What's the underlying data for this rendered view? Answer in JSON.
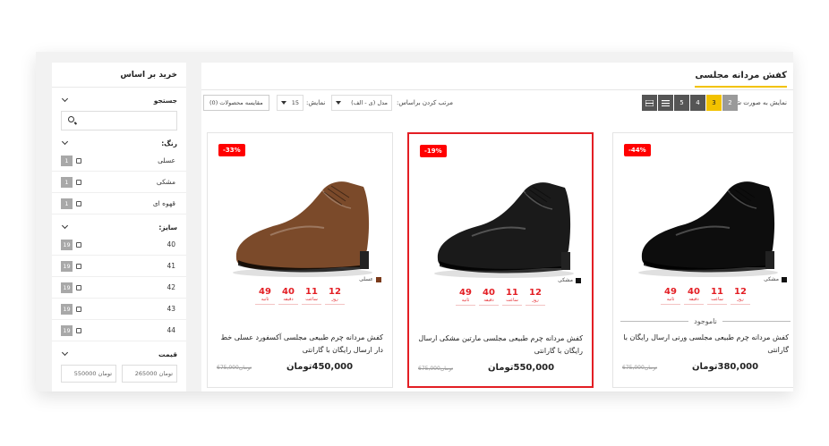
{
  "sidebar": {
    "title": "خرید بر اساس",
    "search_label": "جستجو",
    "color_label": "رنگ:",
    "colors": [
      {
        "label": "عسلی",
        "count": "1"
      },
      {
        "label": "مشکی",
        "count": "1"
      },
      {
        "label": "قهوه ای",
        "count": "1"
      }
    ],
    "size_label": "سایز:",
    "sizes": [
      {
        "label": "40",
        "count": "19"
      },
      {
        "label": "41",
        "count": "19"
      },
      {
        "label": "42",
        "count": "19"
      },
      {
        "label": "43",
        "count": "19"
      },
      {
        "label": "44",
        "count": "19"
      }
    ],
    "price_label": "قیمت",
    "price_min": "تومان 265000",
    "price_max": "تومان 550000"
  },
  "main": {
    "title": "کفش مردانه مجلسی",
    "view_label": "نمایش به صورت شبکه:",
    "pages": [
      "2",
      "3",
      "4",
      "5"
    ],
    "active_page": "3",
    "sort_label": "مرتب کردن براساس:",
    "sort_value": "مدل (ی - الف)",
    "show_label": "نمایش:",
    "show_value": "15",
    "compare_label": "مقایسه محصولات (0)"
  },
  "products": [
    {
      "badge": "-44%",
      "color_name": "مشکی",
      "swatch": "#111111",
      "timer": {
        "days": "12",
        "hours": "11",
        "minutes": "40",
        "seconds": "49"
      },
      "timer_units": {
        "days": "روز",
        "hours": "ساعت",
        "minutes": "دقیقه",
        "seconds": "ثانیه"
      },
      "out_of_stock": "ناموجود",
      "name": "کفش مردانه چرم طبیعی مجلسی ورنی ارسال رایگان با گارانتی",
      "old_price": "675,000تومان",
      "price": "380,000تومان",
      "highlighted": false,
      "shoe_color": "#0d0d0d"
    },
    {
      "badge": "-19%",
      "color_name": "مشکی",
      "swatch": "#111111",
      "timer": {
        "days": "12",
        "hours": "11",
        "minutes": "40",
        "seconds": "49"
      },
      "timer_units": {
        "days": "روز",
        "hours": "ساعت",
        "minutes": "دقیقه",
        "seconds": "ثانیه"
      },
      "out_of_stock": "",
      "name": "کفش مردانه چرم طبیعی مجلسی مارتین مشکی ارسال رایگان با گارانتی",
      "old_price": "675,000تومان",
      "price": "550,000تومان",
      "highlighted": true,
      "shoe_color": "#1a1a1a"
    },
    {
      "badge": "-33%",
      "color_name": "عسلی",
      "swatch": "#7a3a1a",
      "timer": {
        "days": "12",
        "hours": "11",
        "minutes": "40",
        "seconds": "49"
      },
      "timer_units": {
        "days": "روز",
        "hours": "ساعت",
        "minutes": "دقیقه",
        "seconds": "ثانیه"
      },
      "out_of_stock": "",
      "name": "کفش مردانه چرم طبیعی مجلسی آکسفورد عسلی خط دار ارسال رایگان با گارانتی",
      "old_price": "675,000تومان",
      "price": "450,000تومان",
      "highlighted": false,
      "shoe_color": "#7b4a2a"
    }
  ],
  "colors": {
    "accent": "#f2c200",
    "sale": "#ff0000",
    "highlight": "#e31e24"
  }
}
